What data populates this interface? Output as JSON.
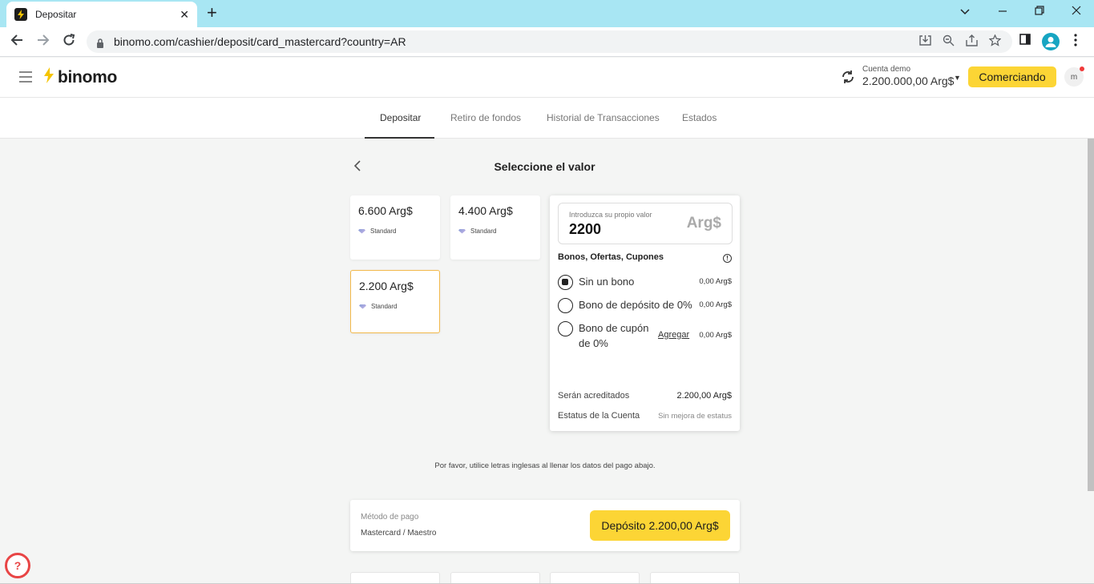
{
  "browser": {
    "tab_title": "Depositar",
    "url": "binomo.com/cashier/deposit/card_mastercard?country=AR"
  },
  "header": {
    "logo_text": "binomo",
    "account_label": "Cuenta demo",
    "account_balance": "2.200.000,00 Arg$",
    "trade_button": "Comerciando",
    "avatar_initial": "m"
  },
  "section_tabs": [
    {
      "label": "Depositar",
      "active": true
    },
    {
      "label": "Retiro de fondos",
      "active": false
    },
    {
      "label": "Historial de Transacciones",
      "active": false
    },
    {
      "label": "Estados",
      "active": false
    }
  ],
  "main": {
    "title": "Seleccione el valor",
    "amounts": [
      {
        "value": "6.600 Arg$",
        "tag": "Standard",
        "selected": false
      },
      {
        "value": "4.400 Arg$",
        "tag": "Standard",
        "selected": false
      },
      {
        "value": "2.200 Arg$",
        "tag": "Standard",
        "selected": true
      }
    ],
    "custom_value": {
      "label": "Introduzca su propio valor",
      "value": "2200",
      "currency": "Arg$"
    },
    "bonus": {
      "heading": "Bonos, Ofertas, Cupones",
      "options": [
        {
          "label": "Sin un bono",
          "amount": "0,00 Arg$",
          "checked": true
        },
        {
          "label": "Bono de depósito de 0%",
          "amount": "0,00 Arg$",
          "checked": false
        },
        {
          "label_line1": "Bono de cupón",
          "label_line2": "de 0%",
          "link": "Agregar",
          "amount": "0,00 Arg$",
          "checked": false
        }
      ],
      "credited_label": "Serán acreditados",
      "credited_value": "2.200,00 Arg$",
      "status_label": "Estatus de la Cuenta",
      "status_value": "Sin mejora de estatus"
    },
    "notice": "Por favor, utilice letras inglesas al llenar los datos del pago abajo.",
    "payment": {
      "method_label": "Método de pago",
      "method_value": "Mastercard / Maestro",
      "deposit_button": "Depósito 2.200,00 Arg$"
    }
  }
}
